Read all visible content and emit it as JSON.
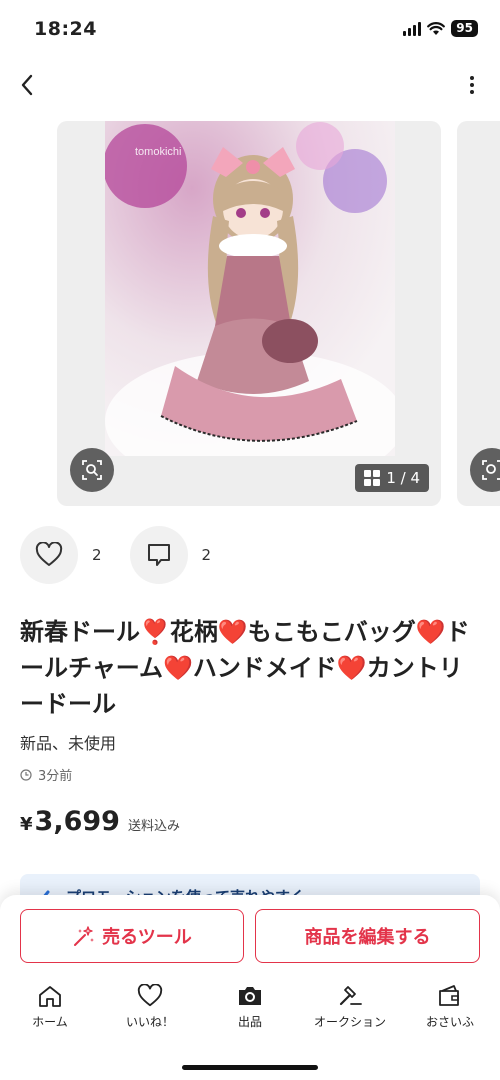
{
  "status_bar": {
    "time": "18:24",
    "battery": "95"
  },
  "product": {
    "image_count": "1 / 4",
    "watermark": "tomokichi",
    "likes": "2",
    "comments": "2",
    "title": "新春ドール❣️花柄❤️もこもこバッグ❤️ドールチャーム❤️ハンドメイド❤️カントリードール",
    "condition": "新品、未使用",
    "posted": "3分前",
    "currency": "¥",
    "price": "3,699",
    "shipping": "送料込み"
  },
  "promo": {
    "text": "プロモーションを使って売れやすく"
  },
  "actions": {
    "sell_tool": "売るツール",
    "edit": "商品を編集する"
  },
  "tabbar": {
    "items": [
      {
        "label": "ホーム",
        "icon": "home-icon"
      },
      {
        "label": "いいね！",
        "icon": "heart-icon"
      },
      {
        "label": "出品",
        "icon": "camera-icon"
      },
      {
        "label": "オークション",
        "icon": "gavel-icon"
      },
      {
        "label": "おさいふ",
        "icon": "wallet-icon"
      }
    ]
  },
  "colors": {
    "accent": "#e3344a",
    "promo_bg": "#e9f1fb"
  }
}
